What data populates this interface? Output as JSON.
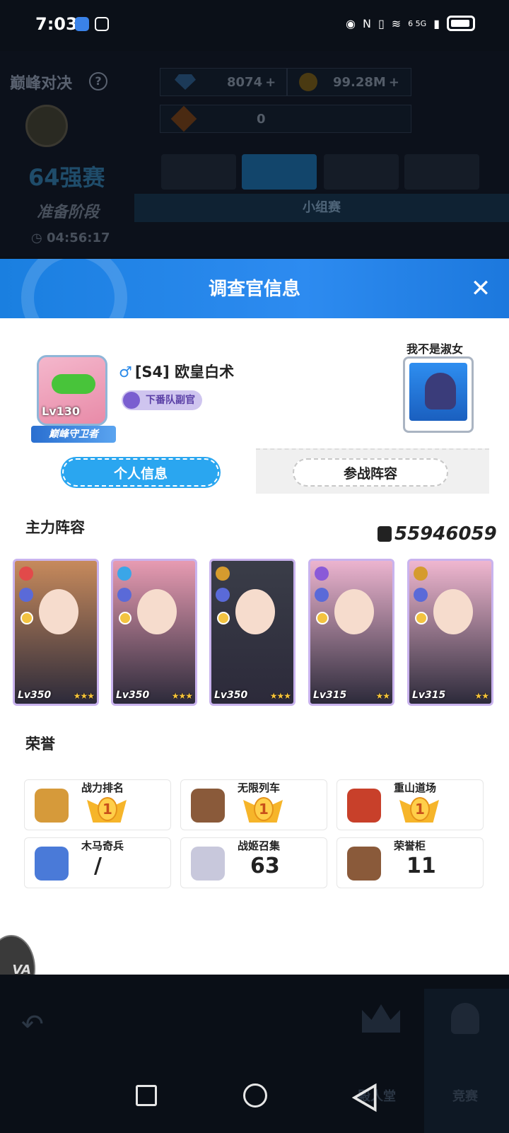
{
  "status_bar": {
    "time": "7:03",
    "indicators": "6 5G"
  },
  "background": {
    "mode_title": "巅峰对决",
    "stage": "64强赛",
    "phase": "准备阶段",
    "timer": "04:56:17",
    "diamonds": "8074",
    "gold": "99.28M",
    "tickets": "0",
    "group_label": "小组赛",
    "bottom_tabs": [
      "殿人堂",
      "竞赛"
    ]
  },
  "modal": {
    "title": "调查官信息",
    "player": {
      "level": "Lv130",
      "frame_badge": "巅峰守卫者",
      "gender_symbol": "♂",
      "name": "[S4] 欧皇白术",
      "title_badge": "下番队副官"
    },
    "guild": {
      "name": "我不是淑女"
    },
    "tabs": [
      "个人信息",
      "参战阵容"
    ],
    "lineup": {
      "title": "主力阵容",
      "power": "55946059",
      "cards": [
        {
          "level": "Lv350",
          "stars": "★★★",
          "el_color": "#e24a4a",
          "bg": "#c78a5c"
        },
        {
          "level": "Lv350",
          "stars": "★★★",
          "el_color": "#3aa6e8",
          "bg": "#e79bb2"
        },
        {
          "level": "Lv350",
          "stars": "★★★",
          "el_color": "#d59b2e",
          "bg": "#3a3d48"
        },
        {
          "level": "Lv315",
          "stars": "★★",
          "el_color": "#8a5ad8",
          "bg": "#ecb4cf"
        },
        {
          "level": "Lv315",
          "stars": "★★",
          "el_color": "#d59b2e",
          "bg": "#f0b7d0"
        }
      ]
    },
    "honor": {
      "title": "荣誉",
      "items": [
        {
          "label": "战力排名",
          "rank": "1",
          "icon": "fist-icon",
          "value": ""
        },
        {
          "label": "无限列车",
          "rank": "1",
          "icon": "train-icon",
          "value": ""
        },
        {
          "label": "重山道场",
          "rank": "1",
          "icon": "drum-icon",
          "value": ""
        },
        {
          "label": "木马奇兵",
          "rank": "",
          "icon": "chess-knight-icon",
          "value": "/"
        },
        {
          "label": "战姬召集",
          "rank": "",
          "icon": "silhouette-icon",
          "value": "63"
        },
        {
          "label": "荣誉柜",
          "rank": "",
          "icon": "cabinet-icon",
          "value": "11"
        }
      ]
    }
  },
  "side_logo": "VA",
  "colors": {
    "header_blue": "#1f82e6",
    "tab_active": "#2aa6f0",
    "card_border": "#c9b3ee",
    "medal_gold": "#f6b52a"
  }
}
